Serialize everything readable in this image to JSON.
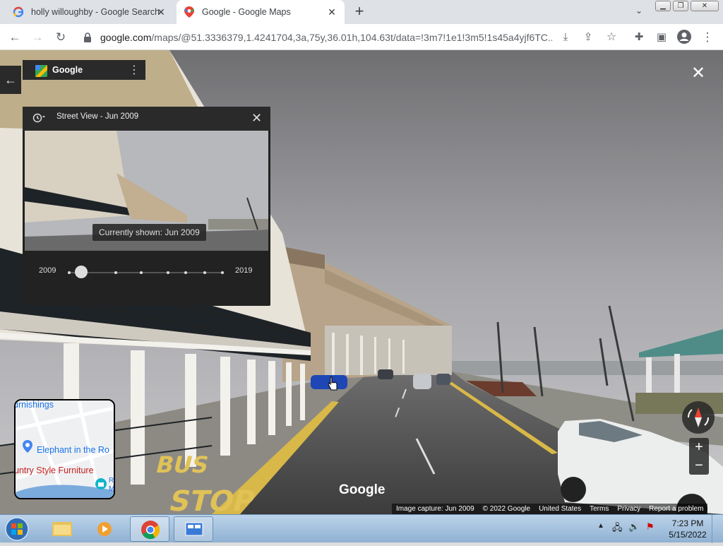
{
  "browser": {
    "tabs": [
      {
        "title": "holly willoughby - Google Search",
        "icon": "google-g-icon"
      },
      {
        "title": "Google - Google Maps",
        "icon": "google-maps-pin-icon",
        "active": true
      }
    ],
    "url": {
      "domain": "google.com",
      "path": "/maps/@51.3336379,1.4241704,3a,75y,36.01h,104.63t/data=!3m7!1e1!3m5!1s45a4yjf6TC..."
    }
  },
  "panel": {
    "brand": "Google",
    "title": "Street View - Jun 2009",
    "tooltip": "Currently shown: Jun 2009",
    "year_start": "2009",
    "year_end": "2019"
  },
  "minimap": {
    "label_top": "urnishings",
    "label_poi": "Elephant in the Ro",
    "label_bottom": "untry Style Furniture",
    "label_small_1": "R",
    "label_small_2": "M"
  },
  "street": {
    "road_text_1": "BUS",
    "road_text_2": "STOP",
    "watermark": "Google"
  },
  "footer": {
    "capture": "Image capture: Jun 2009",
    "copyright": "© 2022 Google",
    "region": "United States",
    "terms": "Terms",
    "privacy": "Privacy",
    "report": "Report a problem"
  },
  "taskbar": {
    "time": "7:23 PM",
    "date": "5/15/2022"
  },
  "colors": {
    "maps_red": "#ea4335",
    "google_blue": "#4285f4",
    "google_green": "#34a853",
    "google_yellow": "#fbbc05"
  }
}
